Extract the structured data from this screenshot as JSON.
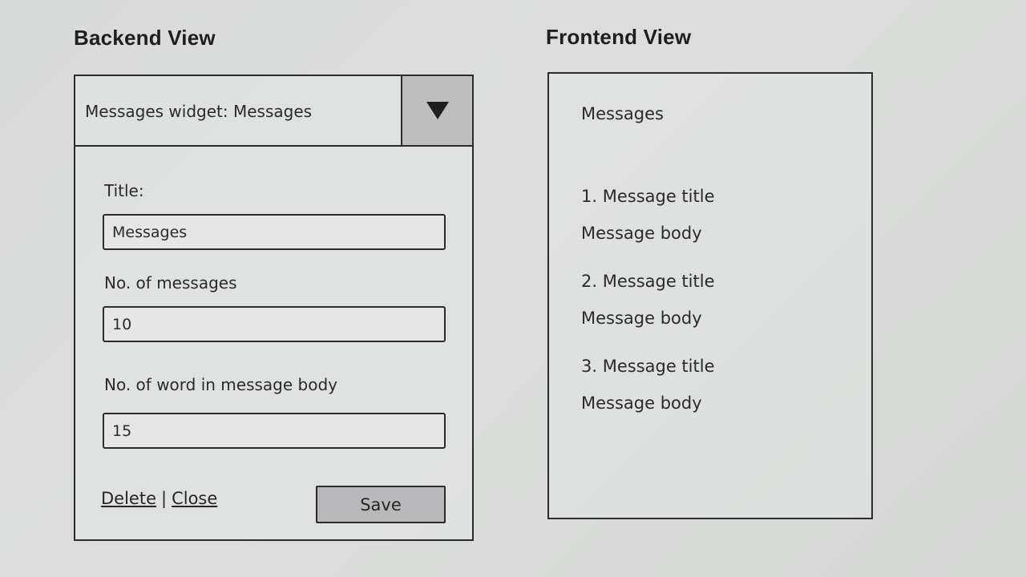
{
  "backend": {
    "heading": "Backend View",
    "widget_header": "Messages widget: Messages",
    "fields": [
      {
        "label": "Title:",
        "value": "Messages"
      },
      {
        "label": "No. of messages",
        "value": "10"
      },
      {
        "label": "No. of word in message body",
        "value": "15"
      }
    ],
    "delete_label": "Delete",
    "separator": "|",
    "close_label": "Close",
    "save_label": "Save",
    "dropdown_icon": "triangle-down-icon"
  },
  "frontend": {
    "heading": "Frontend View",
    "title": "Messages",
    "messages": [
      {
        "title": "1. Message title",
        "body": "Message body"
      },
      {
        "title": "2. Message title",
        "body": "Message body"
      },
      {
        "title": "3. Message title",
        "body": "Message body"
      }
    ]
  }
}
